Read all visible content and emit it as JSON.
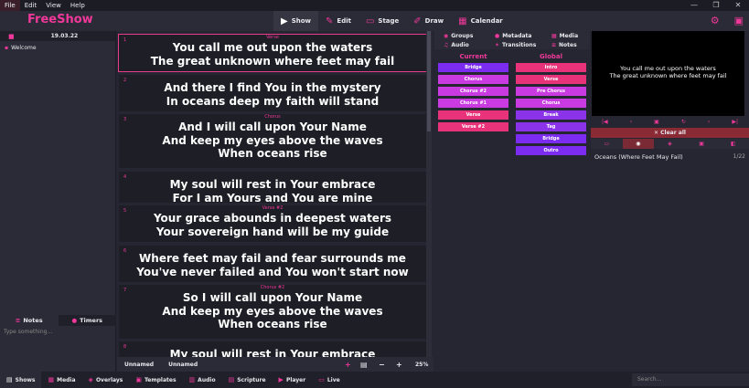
{
  "menubar": {
    "items": [
      "File",
      "Edit",
      "View",
      "Help"
    ]
  },
  "window_controls": {
    "minimize": "—",
    "restore": "❐",
    "close": "✕"
  },
  "app": {
    "name": "FreeShow"
  },
  "nav_tabs": [
    {
      "label": "Show",
      "icon": "screen-icon"
    },
    {
      "label": "Edit",
      "icon": "pencil-icon"
    },
    {
      "label": "Stage",
      "icon": "stage-icon"
    },
    {
      "label": "Draw",
      "icon": "draw-icon"
    },
    {
      "label": "Calendar",
      "icon": "calendar-icon"
    }
  ],
  "project": {
    "date": "19.03.22",
    "items": [
      "Welcome"
    ]
  },
  "notes_tabs": [
    "Notes",
    "Timers"
  ],
  "notes": {
    "placeholder": "Type something..."
  },
  "slides": [
    {
      "num": "1",
      "group": "Verse",
      "lines": [
        "You call me out upon the waters",
        "The great unknown where feet may fail"
      ]
    },
    {
      "num": "2",
      "group": "",
      "lines": [
        "And there I find You in the mystery",
        "In oceans deep my faith will stand"
      ]
    },
    {
      "num": "3",
      "group": "Chorus",
      "lines": [
        "And I will call upon Your Name",
        "And keep my eyes above the waves",
        "When oceans rise"
      ]
    },
    {
      "num": "4",
      "group": "",
      "lines": [
        "My soul will rest in Your embrace",
        "For I am Yours and You are mine"
      ]
    },
    {
      "num": "5",
      "group": "Verse #2",
      "lines": [
        "Your grace abounds in deepest waters",
        "Your sovereign hand will be my guide"
      ]
    },
    {
      "num": "6",
      "group": "",
      "lines": [
        "Where feet may fail and fear surrounds me",
        "You've never failed and You won't start now"
      ]
    },
    {
      "num": "7",
      "group": "Chorus #2",
      "lines": [
        "So I will call upon Your Name",
        "And keep my eyes above the waves",
        "When oceans rise"
      ]
    },
    {
      "num": "8",
      "group": "",
      "lines": [
        "My soul will rest in Your embrace"
      ]
    }
  ],
  "slides_footer": {
    "tabs": [
      "Unnamed",
      "Unnamed"
    ],
    "zoom": "25%"
  },
  "groups_tabs": {
    "row1": [
      "Groups",
      "Metadata",
      "Media"
    ],
    "row2": [
      "Audio",
      "Transitions",
      "Notes"
    ]
  },
  "groups": {
    "current_title": "Current",
    "global_title": "Global",
    "current": [
      {
        "label": "Bridge",
        "color": "#7b2cf0"
      },
      {
        "label": "Chorus",
        "color": "#c93be0"
      },
      {
        "label": "Chorus #2",
        "color": "#c93be0"
      },
      {
        "label": "Chorus #1",
        "color": "#c93be0"
      },
      {
        "label": "Verse",
        "color": "#e8337a"
      },
      {
        "label": "Verse #2",
        "color": "#e8337a"
      }
    ],
    "global": [
      {
        "label": "Intro",
        "color": "#e8337a"
      },
      {
        "label": "Verse",
        "color": "#e8337a"
      },
      {
        "label": "Pre Chorus",
        "color": "#c93be0"
      },
      {
        "label": "Chorus",
        "color": "#c93be0"
      },
      {
        "label": "Break",
        "color": "#8a33e8"
      },
      {
        "label": "Tag",
        "color": "#8a33e8"
      },
      {
        "label": "Bridge",
        "color": "#7b2cf0"
      },
      {
        "label": "Outro",
        "color": "#7b2cf0"
      }
    ]
  },
  "preview": {
    "lines": [
      "You call me out upon the waters",
      "The great unknown where feet may fail"
    ]
  },
  "output": {
    "clear_all": "Clear all"
  },
  "current_show": {
    "name": "Oceans (Where Feet May Fail)",
    "count": "1/22"
  },
  "bottom_tabs": [
    "Shows",
    "Media",
    "Overlays",
    "Templates",
    "Audio",
    "Scripture",
    "Player",
    "Live"
  ],
  "search": {
    "placeholder": "Search..."
  },
  "colors": {
    "accent": "#f0389a",
    "background": "#242530",
    "clear": "#8a2a35"
  }
}
